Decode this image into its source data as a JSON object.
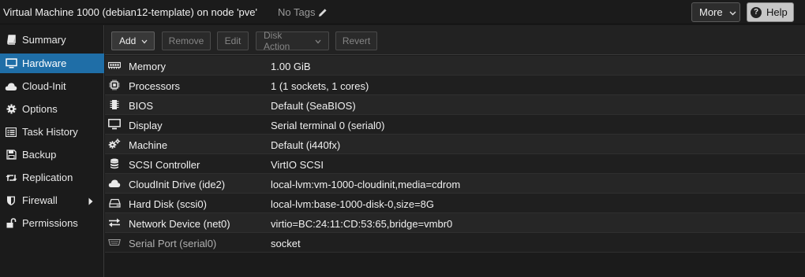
{
  "header": {
    "title": "Virtual Machine 1000 (debian12-template) on node 'pve'",
    "tags": "No Tags",
    "more_label": "More",
    "help_label": "Help"
  },
  "sidebar": {
    "items": [
      {
        "label": "Summary",
        "icon": "book-icon"
      },
      {
        "label": "Hardware",
        "icon": "monitor-icon",
        "active": true
      },
      {
        "label": "Cloud-Init",
        "icon": "cloud-icon"
      },
      {
        "label": "Options",
        "icon": "gear-icon"
      },
      {
        "label": "Task History",
        "icon": "list-icon"
      },
      {
        "label": "Backup",
        "icon": "floppy-icon"
      },
      {
        "label": "Replication",
        "icon": "retweet-icon"
      },
      {
        "label": "Firewall",
        "icon": "shield-icon"
      },
      {
        "label": "Permissions",
        "icon": "unlock-icon"
      }
    ]
  },
  "toolbar": {
    "add": "Add",
    "remove": "Remove",
    "edit": "Edit",
    "disk_action": "Disk Action",
    "revert": "Revert"
  },
  "hardware": {
    "rows": [
      {
        "name": "Memory",
        "value": "1.00 GiB",
        "icon": "memory-icon"
      },
      {
        "name": "Processors",
        "value": "1 (1 sockets, 1 cores)",
        "icon": "cpu-icon"
      },
      {
        "name": "BIOS",
        "value": "Default (SeaBIOS)",
        "icon": "microchip-icon"
      },
      {
        "name": "Display",
        "value": "Serial terminal 0 (serial0)",
        "icon": "desktop-icon"
      },
      {
        "name": "Machine",
        "value": "Default (i440fx)",
        "icon": "cogs-icon"
      },
      {
        "name": "SCSI Controller",
        "value": "VirtIO SCSI",
        "icon": "database-icon"
      },
      {
        "name": "CloudInit Drive (ide2)",
        "value": "local-lvm:vm-1000-cloudinit,media=cdrom",
        "icon": "cloud-icon"
      },
      {
        "name": "Hard Disk (scsi0)",
        "value": "local-lvm:base-1000-disk-0,size=8G",
        "icon": "hdd-icon"
      },
      {
        "name": "Network Device (net0)",
        "value": "virtio=BC:24:11:CD:53:65,bridge=vmbr0",
        "icon": "exchange-icon"
      },
      {
        "name": "Serial Port (serial0)",
        "value": "socket",
        "icon": "serial-port-icon"
      }
    ]
  }
}
